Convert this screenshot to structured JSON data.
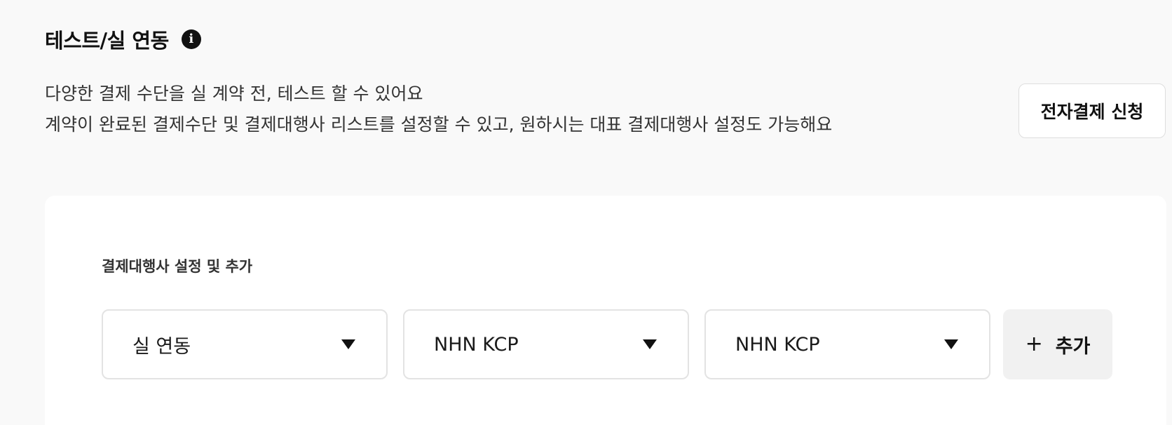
{
  "header": {
    "title": "테스트/실 연동",
    "info_icon_glyph": "i"
  },
  "description": {
    "line1": "다양한 결제 수단을 실 계약 전, 테스트 할 수 있어요",
    "line2": "계약이 완료된 결제수단 및 결제대행사 리스트를 설정할 수 있고, 원하시는 대표 결제대행사 설정도 가능해요"
  },
  "apply_button": {
    "label": "전자결제 신청"
  },
  "pg_settings": {
    "section_label": "결제대행사 설정 및 추가",
    "selects": [
      {
        "value": "실 연동"
      },
      {
        "value": "NHN KCP"
      },
      {
        "value": "NHN KCP"
      }
    ],
    "add_button": {
      "icon": "+",
      "label": "추가"
    }
  },
  "colors": {
    "page_background": "#f9f9f9",
    "card_background": "#ffffff",
    "border": "#e3e3e3",
    "add_button_background": "#f1f1f1",
    "text_primary": "#111111"
  }
}
